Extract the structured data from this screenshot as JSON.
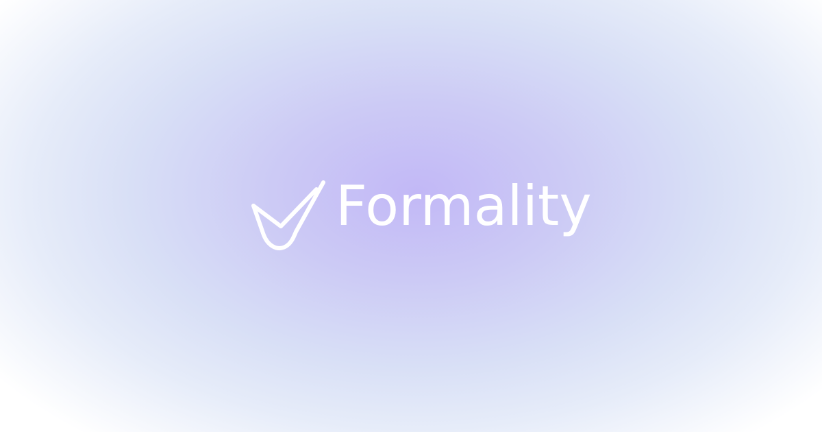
{
  "brand": {
    "name": "Formality",
    "logo_icon": "checkmark-droplet-icon",
    "text_color": "#ffffff"
  },
  "background": {
    "center_color": "#c2b8f6",
    "mid_color": "#d8dff6",
    "edge_color": "#ffffff"
  }
}
